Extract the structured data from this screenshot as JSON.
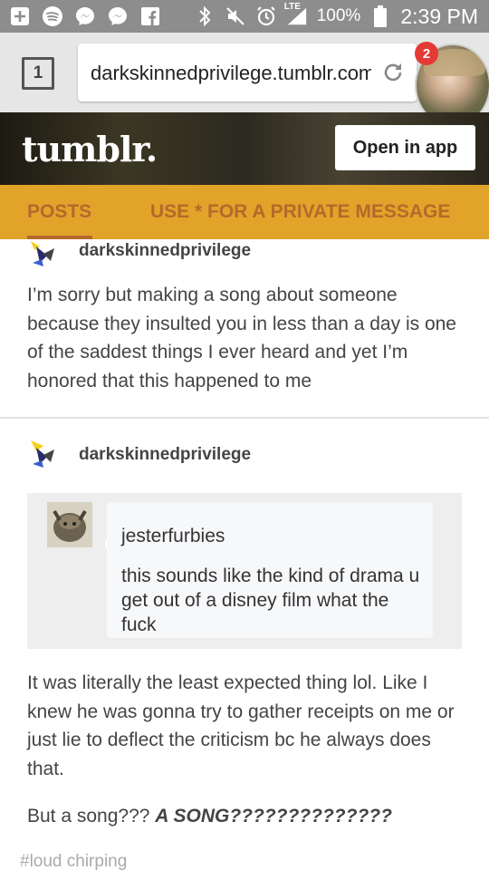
{
  "statusbar": {
    "icons_left": [
      "add-icon",
      "spotify-icon",
      "messenger-icon",
      "messenger-icon",
      "facebook-icon"
    ],
    "icons_right": [
      "bluetooth-icon",
      "mute-icon",
      "alarm-icon",
      "signal-icon",
      "battery-icon"
    ],
    "network_label": "LTE",
    "battery": "100%",
    "time": "2:39 PM"
  },
  "browser": {
    "tab_count": "1",
    "url": "darkskinnedprivilege.tumblr.com",
    "notification_count": "2"
  },
  "tumblr": {
    "logo": "tumblr.",
    "open_app": "Open in app"
  },
  "nav": {
    "posts": "POSTS",
    "private": "USE * FOR A PRIVATE MESSAGE"
  },
  "posts": [
    {
      "username": "darkskinnedprivilege",
      "body": "I’m sorry but making a song about someone because they insulted you in less than a day is one of the saddest things I ever heard and yet I’m honored that this happened to me"
    },
    {
      "username": "darkskinnedprivilege",
      "reblog": {
        "username": "jesterfurbies",
        "text": "this sounds like the kind of drama u get out of a disney film what the fuck"
      },
      "body": "It was literally the least expected thing lol. Like I knew he was gonna try to gather receipts on me or just lie to deflect the criticism bc he always does that.",
      "body2_prefix": "But a song??? ",
      "body2_emphasis": "A SONG??????????????",
      "tag": "#loud chirping"
    }
  ],
  "colors": {
    "status_bar": "#8d8d8d",
    "nav_bg": "#e2a32a",
    "nav_text": "#b5692a",
    "badge": "#e53935"
  }
}
